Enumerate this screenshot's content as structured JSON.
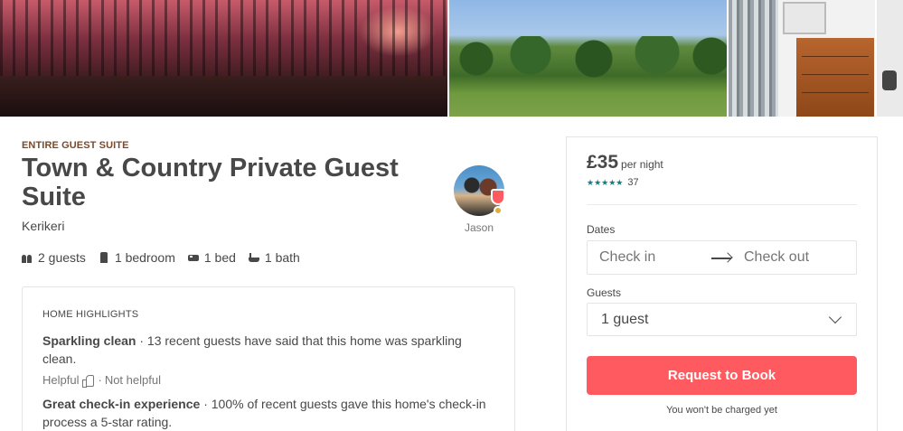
{
  "listing": {
    "type": "ENTIRE GUEST SUITE",
    "title": "Town & Country Private Guest Suite",
    "city": "Kerikeri"
  },
  "host": {
    "name": "Jason"
  },
  "amenities": [
    {
      "icon": "guests-icon",
      "label": "2 guests"
    },
    {
      "icon": "bedroom-icon",
      "label": "1 bedroom"
    },
    {
      "icon": "bed-icon",
      "label": "1 bed"
    },
    {
      "icon": "bath-icon",
      "label": "1 bath"
    }
  ],
  "highlights": {
    "heading": "HOME HIGHLIGHTS",
    "items": [
      {
        "title": "Sparkling clean",
        "text": " · 13 recent guests have said that this home was sparkling clean.",
        "helpful": "Helpful",
        "separator": "·",
        "not_helpful": "Not helpful"
      },
      {
        "title": "Great check-in experience",
        "text": " · 100% of recent guests gave this home's check-in process a 5-star rating."
      }
    ]
  },
  "booking": {
    "price": "£35",
    "per_night": "per night",
    "stars": "★★★★★",
    "review_count": "37",
    "dates_label": "Dates",
    "checkin_placeholder": "Check in",
    "checkout_placeholder": "Check out",
    "guests_label": "Guests",
    "guests_value": "1 guest",
    "button_label": "Request to Book",
    "note": "You won't be charged yet"
  },
  "colors": {
    "brand": "#ff5a5f",
    "stars": "#008489",
    "text": "#484848"
  }
}
